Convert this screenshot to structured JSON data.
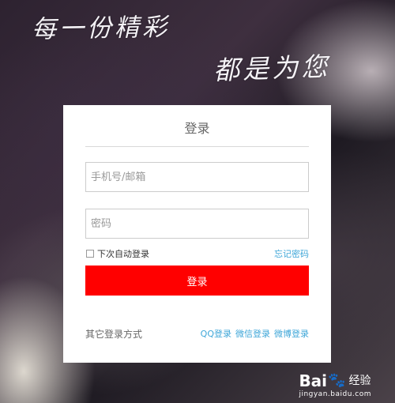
{
  "slogan": {
    "line1": "每一份精彩",
    "line2": "都是为您"
  },
  "login": {
    "title": "登录",
    "phone_placeholder": "手机号/邮箱",
    "password_placeholder": "密码",
    "remember_label": "下次自动登录",
    "remember_checked": false,
    "forgot_label": "忘记密码",
    "submit_label": "登录",
    "other_methods_label": "其它登录方式",
    "social": [
      "QQ登录",
      "微信登录",
      "微博登录"
    ]
  },
  "colors": {
    "submit_bg": "#ff0000",
    "link": "#3ea6d8"
  },
  "watermark": {
    "brand": "Bai",
    "brand_tail": "经验",
    "icon": "paw-icon",
    "url": "jingyan.baidu.com"
  }
}
